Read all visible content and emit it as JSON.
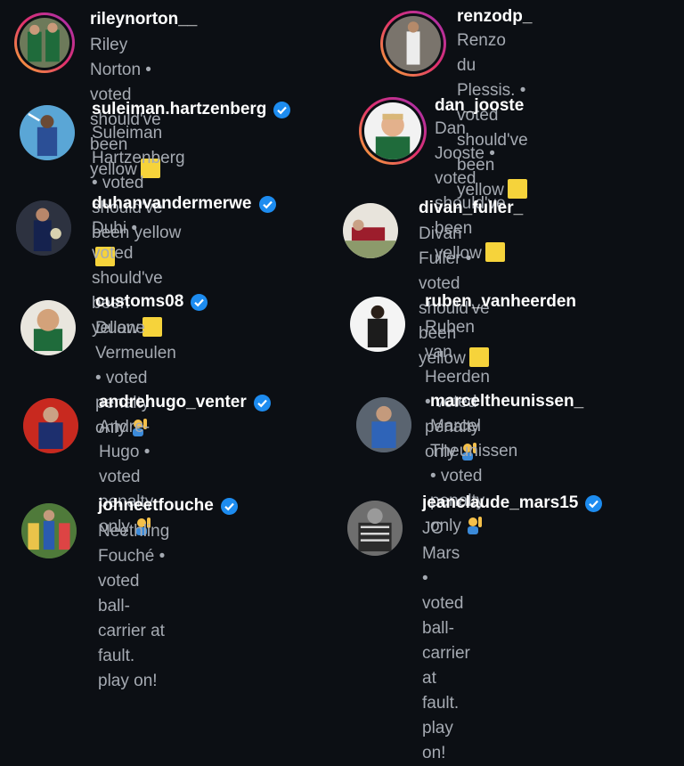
{
  "entries": [
    {
      "username": "rileynorton__",
      "verified": false,
      "display_name": "Riley Norton",
      "vote": "voted should've been yellow",
      "emoji": "yellow-square"
    },
    {
      "username": "renzodp_",
      "verified": false,
      "display_name": "Renzo du Plessis.",
      "vote": "voted should've been yellow",
      "emoji": "yellow-square"
    },
    {
      "username": "suleiman.hartzenberg",
      "verified": true,
      "display_name": "Suleiman Hartzenberg",
      "vote": "voted should've been yellow",
      "emoji": "yellow-square"
    },
    {
      "username": "dan_jooste",
      "verified": false,
      "display_name": "Dan Jooste",
      "vote": "voted should've been yellow",
      "emoji": "yellow-square"
    },
    {
      "username": "duhanvandermerwe",
      "verified": true,
      "display_name": "Duhi",
      "vote": "voted should've been yellow",
      "emoji": "yellow-square"
    },
    {
      "username": "divan_fuller_",
      "verified": false,
      "display_name": "Divan Fuller",
      "vote": "voted should've been yellow",
      "emoji": "yellow-square"
    },
    {
      "username": "customs08",
      "verified": true,
      "display_name": "Duane Vermeulen",
      "vote": "voted penalty only",
      "emoji": "raising-hand"
    },
    {
      "username": "ruben_vanheerden",
      "verified": false,
      "display_name": "Ruben van Heerden",
      "vote": "voted penalty only",
      "emoji": "raising-hand"
    },
    {
      "username": "andrehugo_venter",
      "verified": true,
      "display_name": "Andre-Hugo",
      "vote": "voted penalty only",
      "emoji": "raising-hand"
    },
    {
      "username": "marceltheunissen_",
      "verified": false,
      "display_name": "Marcel Theunissen",
      "vote": "voted penalty only",
      "emoji": "raising-hand"
    },
    {
      "username": "johneetfouche",
      "verified": true,
      "display_name": "Neethling Fouché",
      "vote": "voted ball-carrier at fault. play on!",
      "emoji": ""
    },
    {
      "username": "jeanclaude_mars15",
      "verified": true,
      "display_name": "JC Mars",
      "vote": "voted ball-carrier at fault. play on!",
      "emoji": ""
    }
  ],
  "sub_lines": [
    [
      "Riley Norton • voted should've",
      "been yellow"
    ],
    [
      "Renzo du Plessis. • voted",
      "should've been yellow"
    ],
    [
      "Suleiman Hartzenberg • voted",
      "should've been yellow"
    ],
    [
      "Dan Jooste • voted should've",
      "been yellow"
    ],
    [
      "Duhi • voted should've been",
      "yellow"
    ],
    [
      "Divan Fuller • voted should've",
      "been yellow"
    ],
    [
      "Duane Vermeulen • voted",
      "penalty only"
    ],
    [
      "Ruben van Heerden • voted",
      "penalty only"
    ],
    [
      "Andre-Hugo • voted penalty",
      "only"
    ],
    [
      "Marcel Theunissen • voted",
      "penalty only"
    ],
    [
      "Neethling Fouché • voted",
      "ball-carrier at fault. play on!"
    ],
    [
      "JC Mars • voted ball-carrier at",
      "fault. play on!"
    ]
  ],
  "colors": {
    "background": "#0c0f14",
    "verified": "#1d8cf0",
    "yellow_square": "#f6d33b",
    "secondary_text": "#a5aab2"
  }
}
